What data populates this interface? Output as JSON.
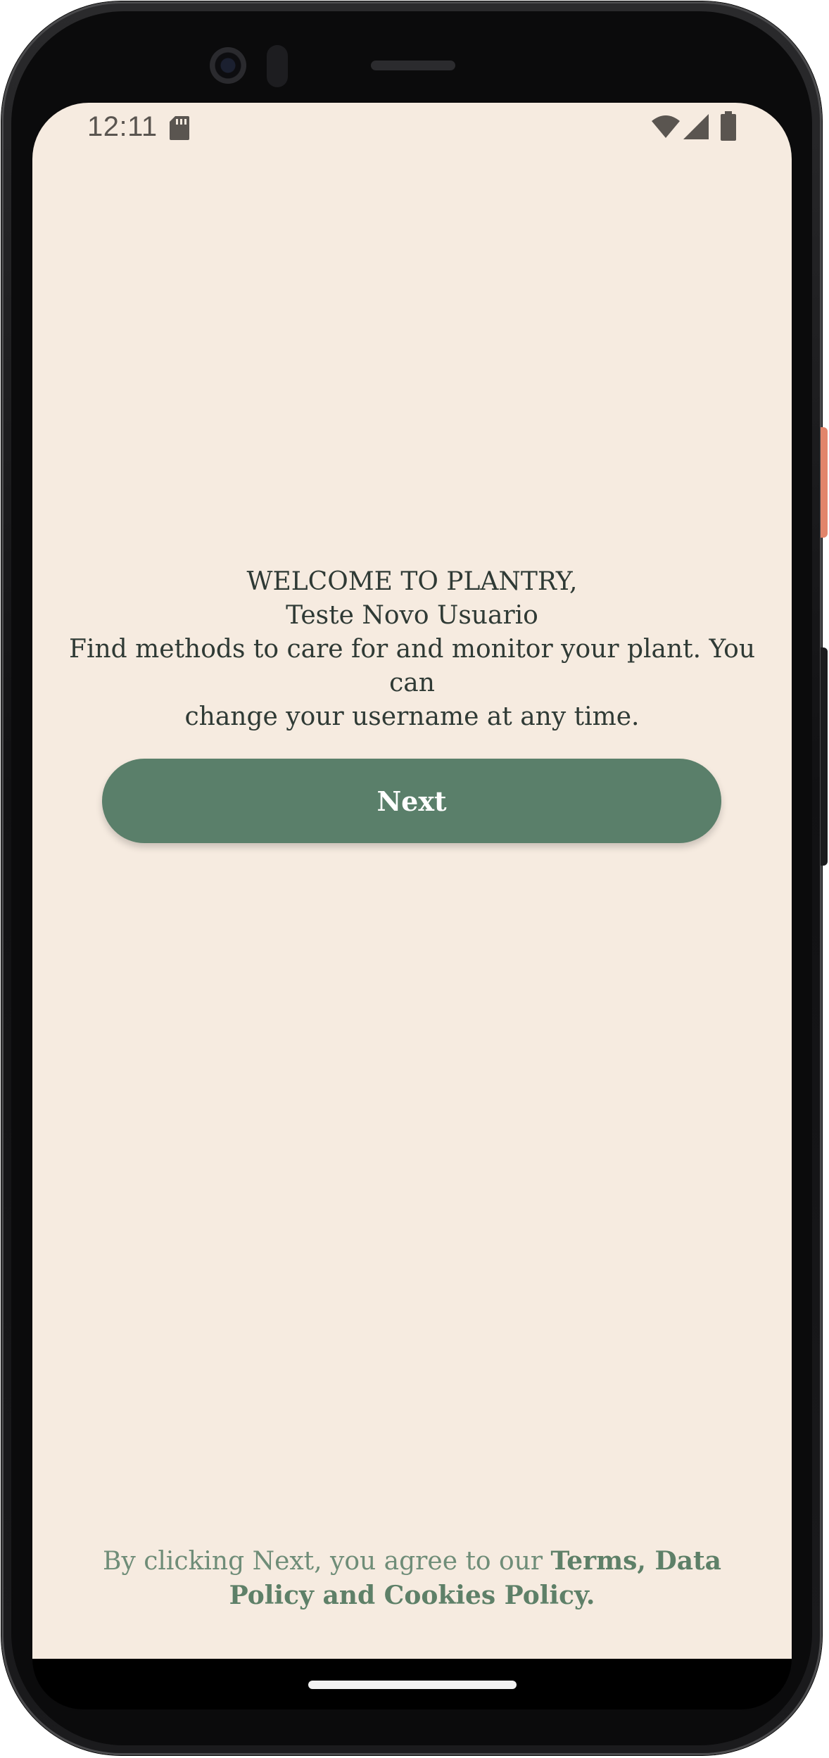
{
  "status_bar": {
    "time": "12:11",
    "icons": [
      "sd-card-icon",
      "wifi-icon",
      "cellular-signal-icon",
      "battery-icon"
    ]
  },
  "welcome": {
    "heading": "WELCOME TO PLANTRY,",
    "username": "Teste Novo Usuario",
    "description_line1": "Find methods to care for and monitor your plant. You can",
    "description_line2": "change your username at any time."
  },
  "actions": {
    "next_label": "Next"
  },
  "footer": {
    "prefix": "By clicking Next, you agree to our ",
    "link_text": "Terms, Data Policy and Cookies Policy."
  },
  "colors": {
    "background": "#f6ebe0",
    "primary_button": "#5a7f6a",
    "text_dark": "#2f3a35",
    "footer_text": "#6f8d78"
  }
}
